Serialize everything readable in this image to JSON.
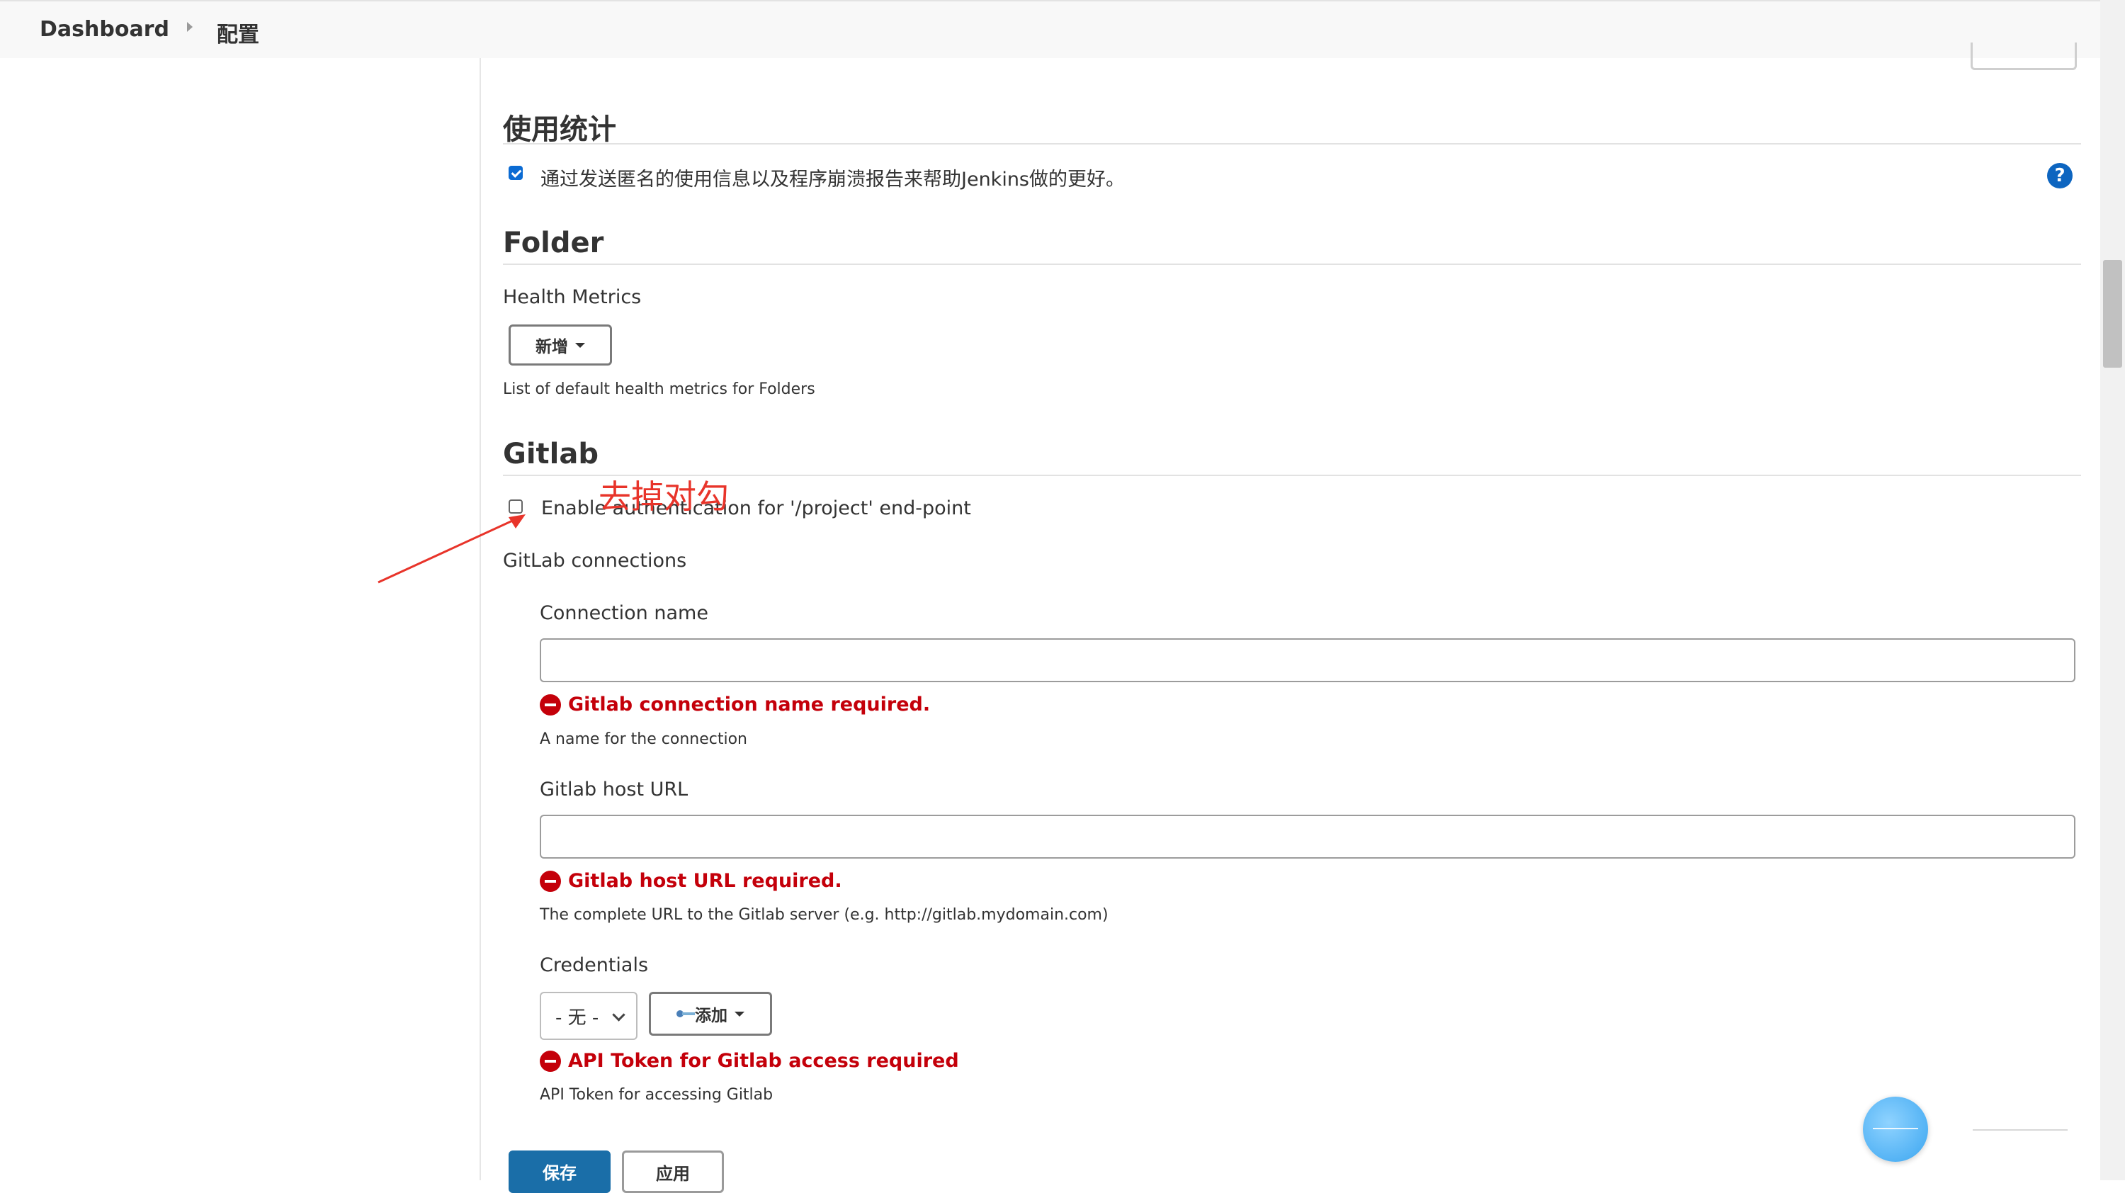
{
  "breadcrumb": {
    "home": "Dashboard",
    "current": "配置"
  },
  "usage": {
    "title": "使用统计",
    "checkbox_label": "通过发送匿名的使用信息以及程序崩溃报告来帮助Jenkins做的更好。",
    "checked": true,
    "help": "?"
  },
  "folder": {
    "title": "Folder",
    "health_metrics_label": "Health Metrics",
    "add_button": "新增",
    "description": "List of default health metrics for Folders"
  },
  "gitlab": {
    "title": "Gitlab",
    "enable_auth_label": "Enable authentication for '/project' end-point",
    "enable_auth_checked": false,
    "connections_label": "GitLab connections",
    "connection_name": {
      "label": "Connection name",
      "value": "",
      "error": "Gitlab connection name required.",
      "description": "A name for the connection"
    },
    "host_url": {
      "label": "Gitlab host URL",
      "value": "",
      "error": "Gitlab host URL required.",
      "description": "The complete URL to the Gitlab server (e.g. http://gitlab.mydomain.com)"
    },
    "credentials": {
      "label": "Credentials",
      "selected": "- 无 -",
      "add_button": "添加",
      "error": "API Token for Gitlab access required",
      "description": "API Token for accessing Gitlab"
    }
  },
  "footer": {
    "save": "保存",
    "apply": "应用"
  },
  "annotation": {
    "text": "去掉对勾",
    "color": "#e8342a"
  },
  "colors": {
    "error": "#c4000a",
    "primary": "#1a6ea8",
    "checkbox": "#0b6bd3"
  }
}
